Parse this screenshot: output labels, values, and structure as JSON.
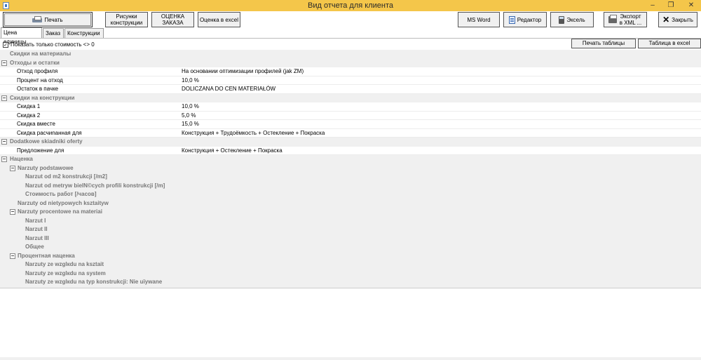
{
  "window": {
    "title": "Вид отчета для клиента",
    "minimize": "–",
    "restore": "❐",
    "close": "✕"
  },
  "toolbar": {
    "print": "Печать",
    "drawings": "Рисунки конструкции",
    "order_eval": "ОЦЕНКА ЗАКАЗА",
    "excel_eval": "Оценка в excel",
    "ms_word": "MS Word",
    "editor": "Редактор",
    "excel": "Эксель",
    "xml_export": "Экспорт в XML ...",
    "close": "Закрыть"
  },
  "tabs": [
    "Цена единицы",
    "Заказ",
    "Конструкции"
  ],
  "options": {
    "show_nonzero": "Показать только стоимость <> 0",
    "show_nonzero_checked": "✓",
    "print_table": "Печать таблицы",
    "table_excel": "Таблица в excel"
  },
  "grid": {
    "rows": [
      {
        "type": "cat",
        "label": "Скидки на материалы"
      },
      {
        "type": "cat",
        "label": "Отходы и остатки",
        "toggle": "−"
      },
      {
        "type": "prop",
        "label": "Отход профиля",
        "value": "На основании оптимизации профилей (jak ZM)"
      },
      {
        "type": "prop",
        "label": "Процент на отход",
        "value": "10,0 %"
      },
      {
        "type": "prop",
        "label": "Остаток в пачке",
        "value": "DOLICZANA DO CEN MATERIAŁÓW"
      },
      {
        "type": "cat",
        "label": "Скидки на конструкции",
        "toggle": "−"
      },
      {
        "type": "prop",
        "label": "Скидка 1",
        "value": "10,0 %"
      },
      {
        "type": "prop",
        "label": "Скидка 2",
        "value": "5,0 %"
      },
      {
        "type": "prop",
        "label": "Скидка вместе",
        "value": "15,0 %"
      },
      {
        "type": "prop",
        "label": "Скидка расчиnанная для",
        "value": "Конструкция + Трудоёмкость  + Остекление + Покраска"
      },
      {
        "type": "cat",
        "label": "Dodatkowe skiadniki oferty",
        "toggle": "−"
      },
      {
        "type": "prop",
        "label": "Предложение для",
        "value": "Конструкция + Остекление + Покраска"
      }
    ],
    "lower_rows": [
      {
        "label": "Наценка",
        "level": 0,
        "toggle": "−"
      },
      {
        "label": "Narzuty podstawowe",
        "level": 1,
        "toggle": "−"
      },
      {
        "label": "Narzut od m2 konstrukcji [/m2]",
        "level": 3
      },
      {
        "label": "Narzut od metryw bielN©cych profili konstrukcji [/m]",
        "level": 3
      },
      {
        "label": "Стоимость работ  [/часов]",
        "level": 3
      },
      {
        "label": "Narzuty od nietypowych ksztaitуw",
        "level": 2
      },
      {
        "label": "Narzuty procentowe na materiai",
        "level": 1,
        "toggle": "−"
      },
      {
        "label": "Narzut I",
        "level": 3
      },
      {
        "label": "Narzut II",
        "level": 3
      },
      {
        "label": "Narzut III",
        "level": 3
      },
      {
        "label": "Общее",
        "level": 3
      },
      {
        "label": "Процентная наценка",
        "level": 1,
        "toggle": "−"
      },
      {
        "label": "Narzuty ze wzglкdu na ksztait",
        "level": 3
      },
      {
        "label": "Narzuty ze wzglкdu na system",
        "level": 3
      },
      {
        "label": "Narzuty ze wzglкdu na typ konstrukcjі: Nie uїywane",
        "level": 3
      }
    ]
  },
  "colors": {
    "titlebar": "#f4c64a",
    "category_bg": "#f0f0f0",
    "category_text": "#777777"
  }
}
